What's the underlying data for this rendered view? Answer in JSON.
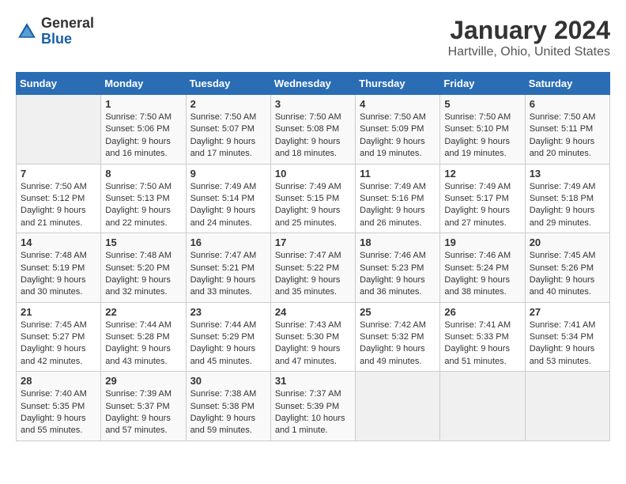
{
  "logo": {
    "general": "General",
    "blue": "Blue"
  },
  "header": {
    "title": "January 2024",
    "subtitle": "Hartville, Ohio, United States"
  },
  "weekdays": [
    "Sunday",
    "Monday",
    "Tuesday",
    "Wednesday",
    "Thursday",
    "Friday",
    "Saturday"
  ],
  "weeks": [
    [
      {
        "day": "",
        "info": ""
      },
      {
        "day": "1",
        "info": "Sunrise: 7:50 AM\nSunset: 5:06 PM\nDaylight: 9 hours\nand 16 minutes."
      },
      {
        "day": "2",
        "info": "Sunrise: 7:50 AM\nSunset: 5:07 PM\nDaylight: 9 hours\nand 17 minutes."
      },
      {
        "day": "3",
        "info": "Sunrise: 7:50 AM\nSunset: 5:08 PM\nDaylight: 9 hours\nand 18 minutes."
      },
      {
        "day": "4",
        "info": "Sunrise: 7:50 AM\nSunset: 5:09 PM\nDaylight: 9 hours\nand 19 minutes."
      },
      {
        "day": "5",
        "info": "Sunrise: 7:50 AM\nSunset: 5:10 PM\nDaylight: 9 hours\nand 19 minutes."
      },
      {
        "day": "6",
        "info": "Sunrise: 7:50 AM\nSunset: 5:11 PM\nDaylight: 9 hours\nand 20 minutes."
      }
    ],
    [
      {
        "day": "7",
        "info": ""
      },
      {
        "day": "8",
        "info": "Sunrise: 7:50 AM\nSunset: 5:13 PM\nDaylight: 9 hours\nand 22 minutes."
      },
      {
        "day": "9",
        "info": "Sunrise: 7:49 AM\nSunset: 5:14 PM\nDaylight: 9 hours\nand 24 minutes."
      },
      {
        "day": "10",
        "info": "Sunrise: 7:49 AM\nSunset: 5:15 PM\nDaylight: 9 hours\nand 25 minutes."
      },
      {
        "day": "11",
        "info": "Sunrise: 7:49 AM\nSunset: 5:16 PM\nDaylight: 9 hours\nand 26 minutes."
      },
      {
        "day": "12",
        "info": "Sunrise: 7:49 AM\nSunset: 5:17 PM\nDaylight: 9 hours\nand 27 minutes."
      },
      {
        "day": "13",
        "info": "Sunrise: 7:49 AM\nSunset: 5:18 PM\nDaylight: 9 hours\nand 29 minutes."
      }
    ],
    [
      {
        "day": "14",
        "info": ""
      },
      {
        "day": "15",
        "info": "Sunrise: 7:48 AM\nSunset: 5:20 PM\nDaylight: 9 hours\nand 32 minutes."
      },
      {
        "day": "16",
        "info": "Sunrise: 7:47 AM\nSunset: 5:21 PM\nDaylight: 9 hours\nand 33 minutes."
      },
      {
        "day": "17",
        "info": "Sunrise: 7:47 AM\nSunset: 5:22 PM\nDaylight: 9 hours\nand 35 minutes."
      },
      {
        "day": "18",
        "info": "Sunrise: 7:46 AM\nSunset: 5:23 PM\nDaylight: 9 hours\nand 36 minutes."
      },
      {
        "day": "19",
        "info": "Sunrise: 7:46 AM\nSunset: 5:24 PM\nDaylight: 9 hours\nand 38 minutes."
      },
      {
        "day": "20",
        "info": "Sunrise: 7:45 AM\nSunset: 5:26 PM\nDaylight: 9 hours\nand 40 minutes."
      }
    ],
    [
      {
        "day": "21",
        "info": ""
      },
      {
        "day": "22",
        "info": "Sunrise: 7:44 AM\nSunset: 5:28 PM\nDaylight: 9 hours\nand 43 minutes."
      },
      {
        "day": "23",
        "info": "Sunrise: 7:44 AM\nSunset: 5:29 PM\nDaylight: 9 hours\nand 45 minutes."
      },
      {
        "day": "24",
        "info": "Sunrise: 7:43 AM\nSunset: 5:30 PM\nDaylight: 9 hours\nand 47 minutes."
      },
      {
        "day": "25",
        "info": "Sunrise: 7:42 AM\nSunset: 5:32 PM\nDaylight: 9 hours\nand 49 minutes."
      },
      {
        "day": "26",
        "info": "Sunrise: 7:41 AM\nSunset: 5:33 PM\nDaylight: 9 hours\nand 51 minutes."
      },
      {
        "day": "27",
        "info": "Sunrise: 7:41 AM\nSunset: 5:34 PM\nDaylight: 9 hours\nand 53 minutes."
      }
    ],
    [
      {
        "day": "28",
        "info": ""
      },
      {
        "day": "29",
        "info": "Sunrise: 7:39 AM\nSunset: 5:37 PM\nDaylight: 9 hours\nand 57 minutes."
      },
      {
        "day": "30",
        "info": "Sunrise: 7:38 AM\nSunset: 5:38 PM\nDaylight: 9 hours\nand 59 minutes."
      },
      {
        "day": "31",
        "info": "Sunrise: 7:37 AM\nSunset: 5:39 PM\nDaylight: 10 hours\nand 1 minute."
      },
      {
        "day": "",
        "info": ""
      },
      {
        "day": "",
        "info": ""
      },
      {
        "day": "",
        "info": ""
      }
    ]
  ],
  "week_sunday_infos": [
    "",
    "Sunrise: 7:50 AM\nSunset: 5:12 PM\nDaylight: 9 hours\nand 21 minutes.",
    "Sunrise: 7:48 AM\nSunset: 5:19 PM\nDaylight: 9 hours\nand 30 minutes.",
    "Sunrise: 7:45 AM\nSunset: 5:27 PM\nDaylight: 9 hours\nand 42 minutes.",
    "Sunrise: 7:40 AM\nSunset: 5:35 PM\nDaylight: 9 hours\nand 55 minutes."
  ]
}
